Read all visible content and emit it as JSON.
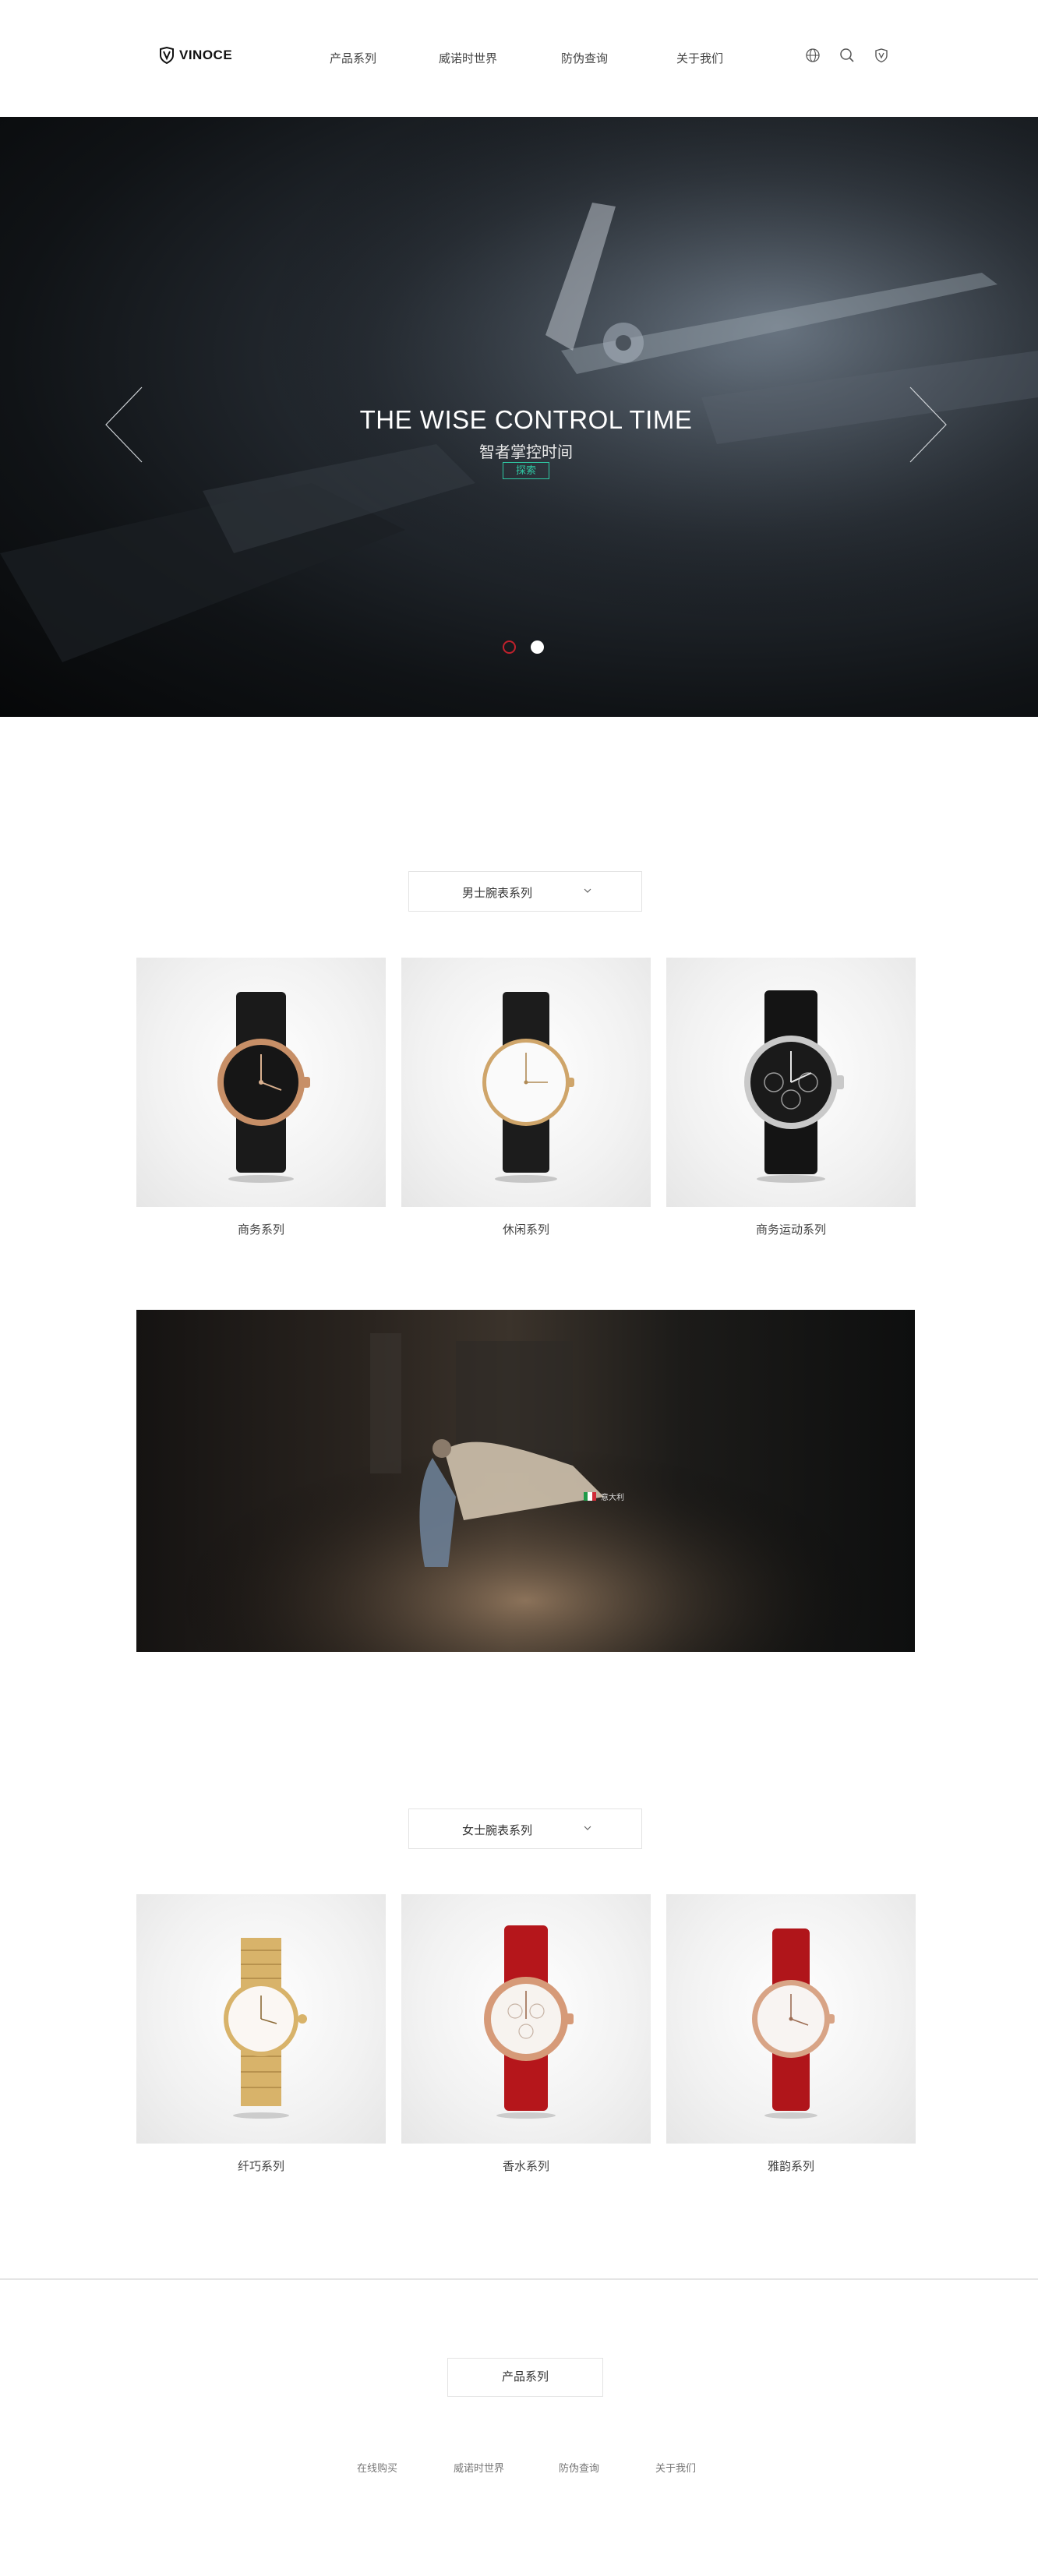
{
  "brand": {
    "name": "VINOCE"
  },
  "nav": {
    "items": [
      {
        "label": "产品系列"
      },
      {
        "label": "威诺时世界"
      },
      {
        "label": "防伪查询"
      },
      {
        "label": "关于我们"
      }
    ],
    "icons": [
      "globe-icon",
      "search-icon",
      "shield-icon"
    ]
  },
  "hero": {
    "title": "THE WISE CONTROL TIME",
    "subtitle": "智者掌控时间",
    "button_label": "探索",
    "slides_total": 2,
    "active_slide": 1,
    "colors": {
      "button": "#2fc9a4",
      "active_dot": "#c0212c"
    }
  },
  "men": {
    "selector_label": "男士腕表系列",
    "products": [
      {
        "label": "商务系列"
      },
      {
        "label": "休闲系列"
      },
      {
        "label": "商务运动系列"
      }
    ]
  },
  "craft": {
    "badge_label": "意大利"
  },
  "women": {
    "selector_label": "女士腕表系列",
    "products": [
      {
        "label": "纤巧系列"
      },
      {
        "label": "香水系列"
      },
      {
        "label": "雅韵系列"
      }
    ]
  },
  "footer": {
    "box_label": "产品系列",
    "links": [
      {
        "label": "在线购买"
      },
      {
        "label": "威诺时世界"
      },
      {
        "label": "防伪查询"
      },
      {
        "label": "关于我们"
      }
    ]
  }
}
